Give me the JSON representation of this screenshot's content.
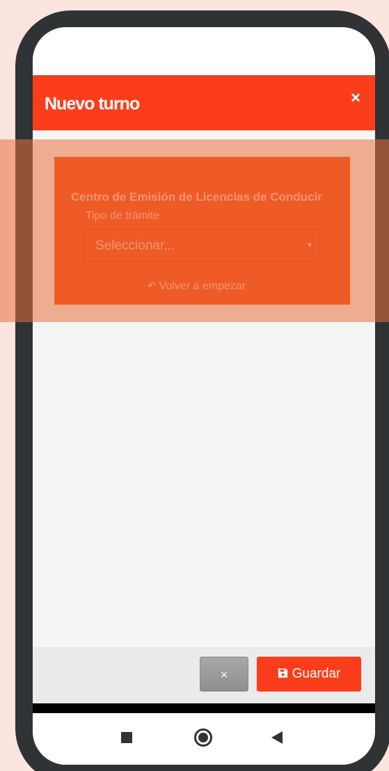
{
  "modal": {
    "title": "Nuevo turno",
    "close_glyph": "×"
  },
  "form": {
    "centro_label": "Centro de Emisión de Licencias de Conducir",
    "tipo_label": "Tipo de trámite",
    "select": {
      "value": "Seleccionar...",
      "caret_glyph": "▾"
    },
    "restart": {
      "icon_glyph": "↶",
      "label": "Volver a empezar"
    }
  },
  "footer": {
    "cancel_glyph": "×",
    "save_label": "Guardar"
  },
  "icons": {
    "close": "close-icon",
    "undo": "undo-icon",
    "save": "floppy-disk-icon",
    "nav_recent": "square-icon",
    "nav_home": "circle-icon",
    "nav_back": "triangle-back-icon"
  },
  "colors": {
    "accent": "#fc3d1b",
    "card": "#f9430f",
    "frame": "#303336",
    "background": "#fde5df"
  }
}
